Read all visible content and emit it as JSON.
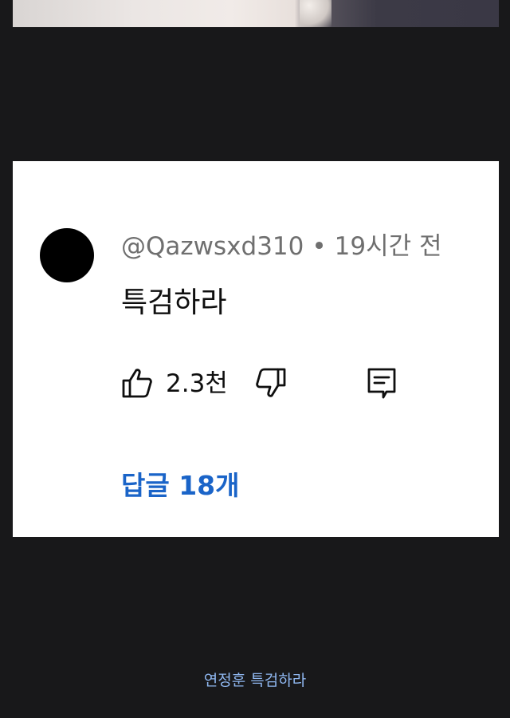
{
  "comment": {
    "username": "@Qazwsxd310",
    "separator": "•",
    "time": "19시간 전",
    "text": "특검하라",
    "likes": "2.3천",
    "replies_label": "답글 18개"
  },
  "caption": "연정훈 특검하라",
  "colors": {
    "background": "#18181a",
    "card": "#ffffff",
    "reply_link": "#1a64c8",
    "caption": "#8fb7f0"
  },
  "icons": {
    "like": "thumbs-up-icon",
    "dislike": "thumbs-down-icon",
    "reply": "comment-icon"
  }
}
